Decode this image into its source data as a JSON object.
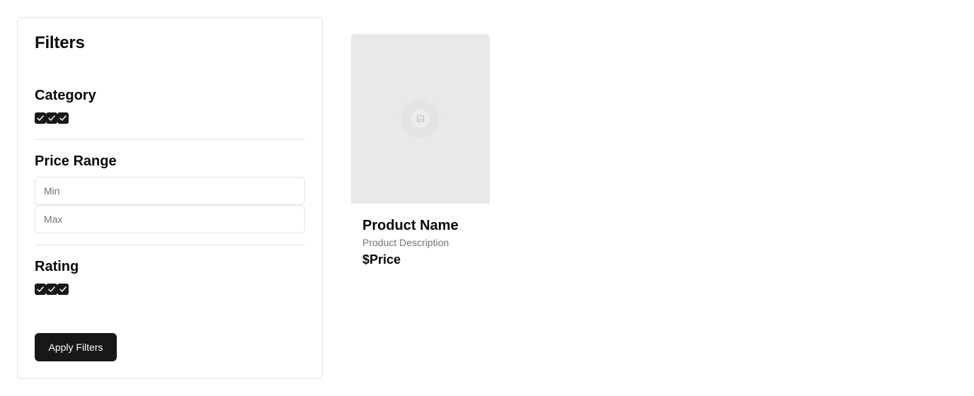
{
  "filters": {
    "title": "Filters",
    "category": {
      "title": "Category",
      "checkboxes": [
        {
          "checked": true
        },
        {
          "checked": true
        },
        {
          "checked": true
        }
      ]
    },
    "price_range": {
      "title": "Price Range",
      "min_placeholder": "Min",
      "max_placeholder": "Max",
      "min_value": "",
      "max_value": ""
    },
    "rating": {
      "title": "Rating",
      "checkboxes": [
        {
          "checked": true
        },
        {
          "checked": true
        },
        {
          "checked": true
        }
      ]
    },
    "apply_label": "Apply Filters"
  },
  "product": {
    "image_icon": "image-placeholder-icon",
    "name": "Product Name",
    "description": "Product Description",
    "price": "$Price"
  },
  "colors": {
    "primary": "#18181b",
    "border": "#e4e4e7",
    "muted_text": "#71717a",
    "image_bg": "#e9e9e9"
  }
}
